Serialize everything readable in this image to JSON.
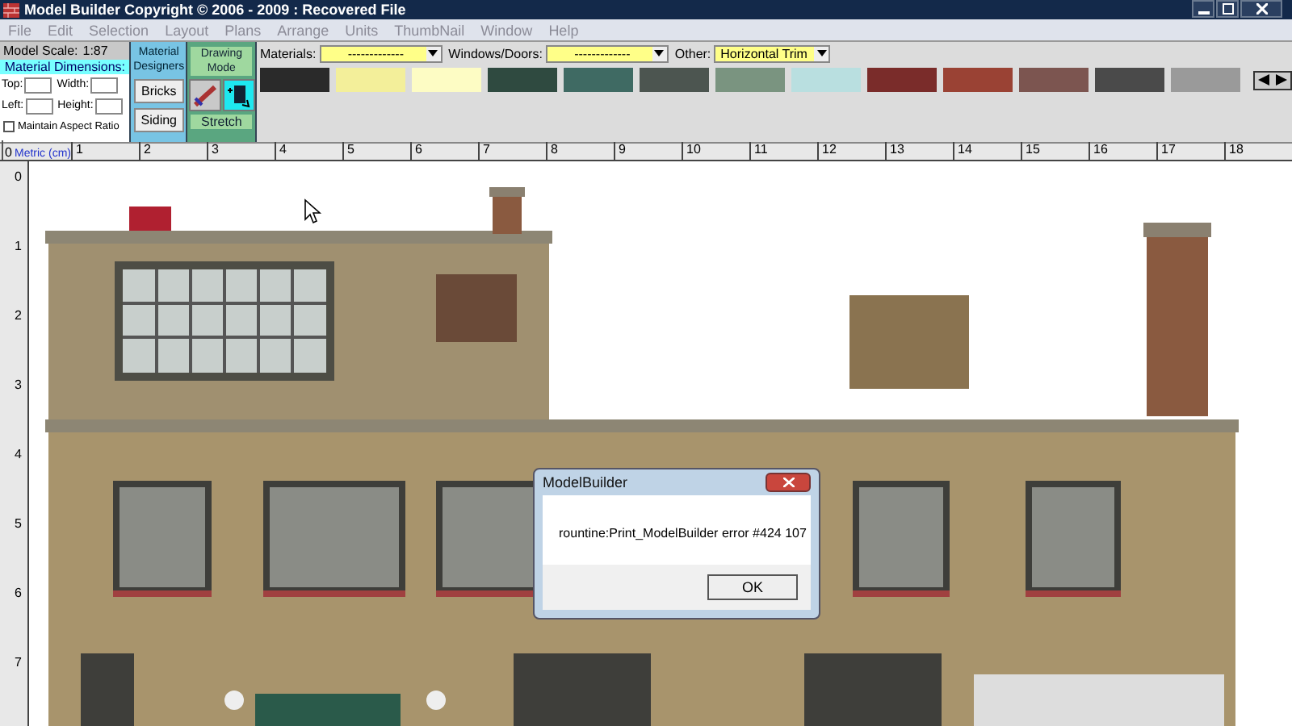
{
  "window": {
    "title": "Model Builder Copyright © 2006 - 2009 : Recovered File"
  },
  "menu": [
    "File",
    "Edit",
    "Selection",
    "Layout",
    "Plans",
    "Arrange",
    "Units",
    "ThumbNail",
    "Window",
    "Help"
  ],
  "model_scale": {
    "label": "Model Scale:",
    "value": "1:87"
  },
  "dimensions": {
    "title": "Material  Dimensions:",
    "fields": [
      {
        "label": "Top:"
      },
      {
        "label": "Width:"
      },
      {
        "label": "Left:"
      },
      {
        "label": "Height:"
      }
    ],
    "aspect": {
      "label": "Maintain Aspect Ratio",
      "checked": false
    }
  },
  "material_designers": {
    "title": "Material Designers",
    "buttons": [
      "Bricks",
      "Siding"
    ]
  },
  "drawing_mode": {
    "title": "Drawing Mode",
    "tools": [
      {
        "selected": false
      },
      {
        "selected": true
      }
    ],
    "mode": "Stretch"
  },
  "pickers": [
    {
      "label": "Materials:",
      "value": "-------------"
    },
    {
      "label": "Windows/Doors:",
      "value": "-------------"
    },
    {
      "label": "Other:",
      "value": "Horizontal Trim"
    }
  ],
  "swatches": [
    {
      "color": "#2a2a2a"
    },
    {
      "color": "#f3ef9a"
    },
    {
      "color": "#fdfcc4"
    },
    {
      "color": "#2f4a40"
    },
    {
      "color": "#3f6a63"
    },
    {
      "color": "#4c5550"
    },
    {
      "color": "#7a9480"
    },
    {
      "color": "#b9dfe0"
    },
    {
      "color": "#7a2c2a"
    },
    {
      "color": "#9a4234"
    },
    {
      "color": "#7c5550"
    },
    {
      "color": "#4a4a4a"
    },
    {
      "color": "#9a9a9a"
    }
  ],
  "ruler": {
    "origin": "0",
    "unit": "Metric (cm)",
    "marks": [
      "1",
      "2",
      "3",
      "4",
      "5",
      "6",
      "7",
      "8",
      "9",
      "10",
      "11",
      "12",
      "13",
      "14",
      "15",
      "16",
      "17",
      "18"
    ]
  },
  "side_ruler": [
    "0",
    "1",
    "2",
    "3",
    "4",
    "5",
    "6",
    "7"
  ],
  "dialog": {
    "title": "ModelBuilder",
    "message": "rountine:Print_ModelBuilder error #424 107",
    "button": "OK"
  }
}
